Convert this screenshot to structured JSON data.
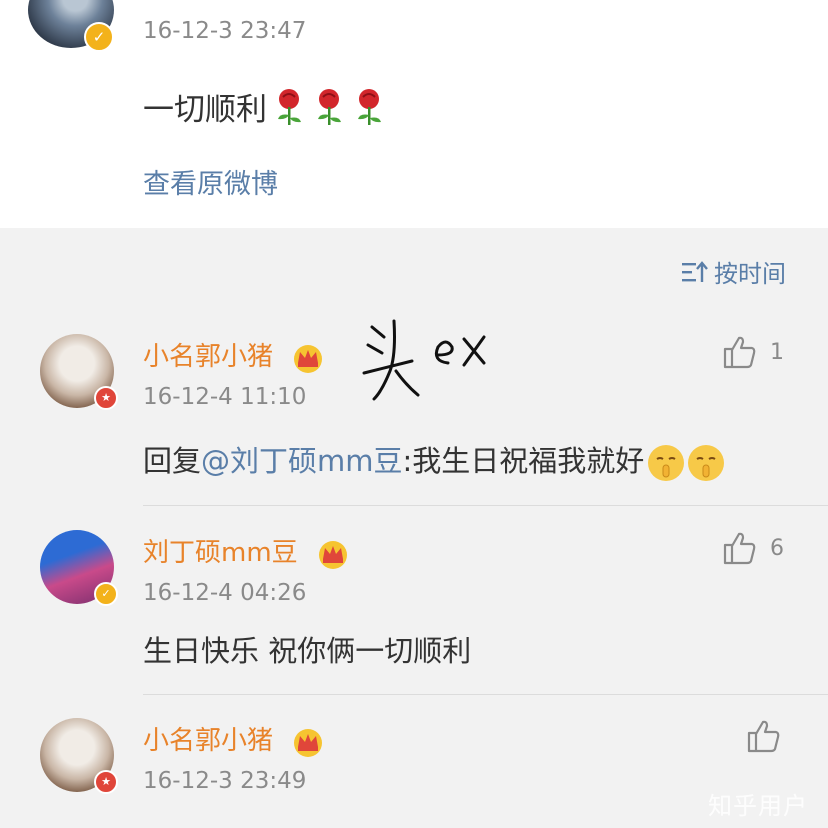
{
  "post": {
    "time": "16-12-3 23:47",
    "text": "一切顺利",
    "view_original": "查看原微博"
  },
  "sort": {
    "label": "按时间"
  },
  "handwritten_note": "头ex",
  "comments": [
    {
      "name": "小名郭小猪",
      "time": "16-12-4 11:10",
      "reply_prefix": "回复",
      "mention": "@刘丁硕mm豆",
      "text": ":我生日祝福我就好",
      "likes": "1"
    },
    {
      "name": "刘丁硕mm豆",
      "time": "16-12-4 04:26",
      "text": "生日快乐 祝你俩一切顺利",
      "likes": "6"
    },
    {
      "name": "小名郭小猪",
      "time": "16-12-3 23:49",
      "text": ""
    }
  ],
  "watermark": "知乎用户",
  "colors": {
    "name": "#e8832a",
    "link": "#5a7ea8",
    "time": "#8a8a8a",
    "badge_gold": "#f3b21b",
    "badge_red": "#e0463a"
  }
}
